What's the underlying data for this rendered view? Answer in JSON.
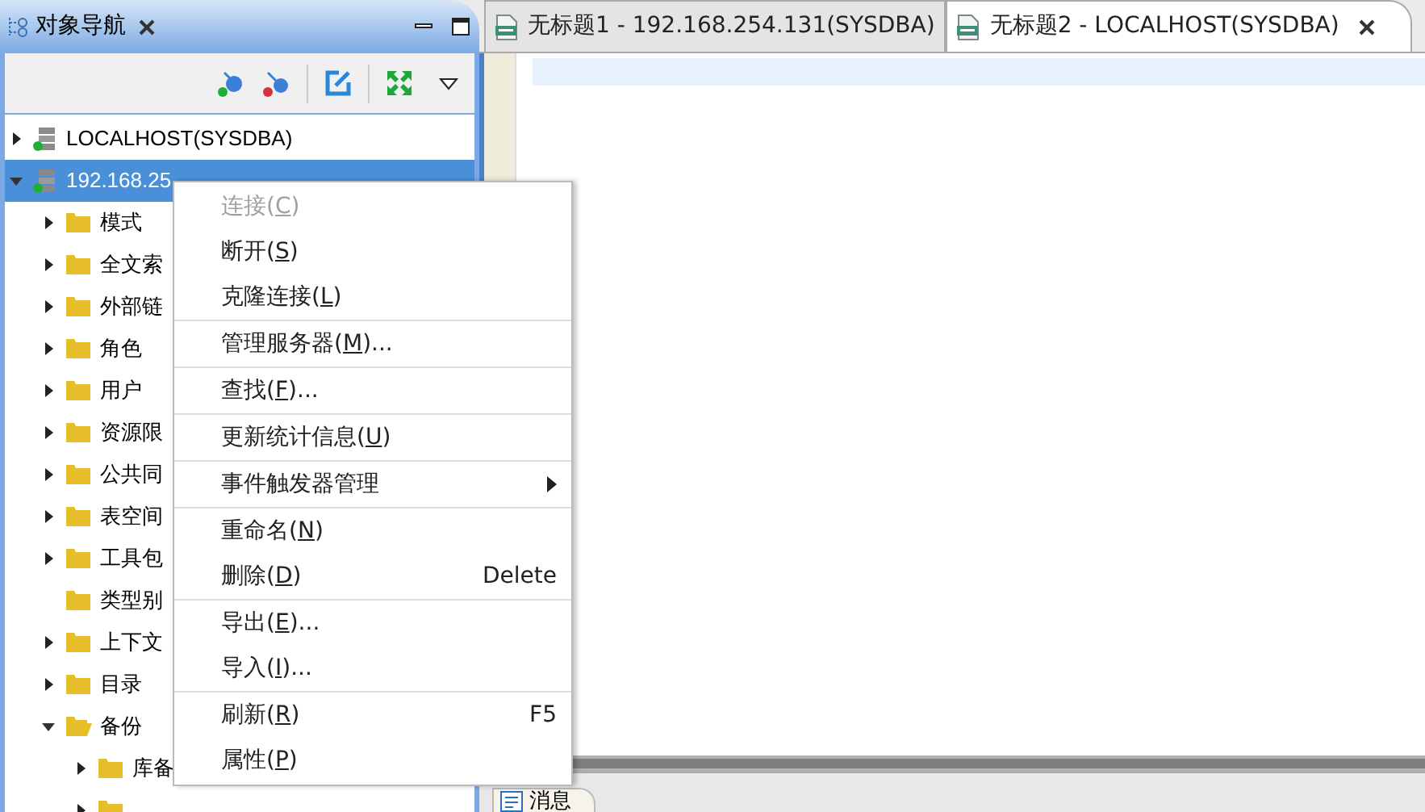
{
  "navigator": {
    "title": "对象导航"
  },
  "tree": [
    {
      "label": "LOCALHOST(SYSDBA)",
      "kind": "server",
      "expanded": false,
      "leaf": false,
      "selected": false
    },
    {
      "label": "192.168.25",
      "kind": "server",
      "expanded": true,
      "leaf": false,
      "selected": true,
      "children": [
        {
          "label": "模式",
          "kind": "folder",
          "expanded": false,
          "leaf": false,
          "selected": false
        },
        {
          "label": "全文索",
          "kind": "folder",
          "expanded": false,
          "leaf": false,
          "selected": false
        },
        {
          "label": "外部链",
          "kind": "folder",
          "expanded": false,
          "leaf": false,
          "selected": false
        },
        {
          "label": "角色",
          "kind": "folder",
          "expanded": false,
          "leaf": false,
          "selected": false
        },
        {
          "label": "用户",
          "kind": "folder",
          "expanded": false,
          "leaf": false,
          "selected": false
        },
        {
          "label": "资源限",
          "kind": "folder",
          "expanded": false,
          "leaf": false,
          "selected": false
        },
        {
          "label": "公共同",
          "kind": "folder",
          "expanded": false,
          "leaf": false,
          "selected": false
        },
        {
          "label": "表空间",
          "kind": "folder",
          "expanded": false,
          "leaf": false,
          "selected": false
        },
        {
          "label": "工具包",
          "kind": "folder",
          "expanded": false,
          "leaf": false,
          "selected": false
        },
        {
          "label": "类型别",
          "kind": "folder",
          "expanded": false,
          "leaf": true,
          "selected": false
        },
        {
          "label": "上下文",
          "kind": "folder",
          "expanded": false,
          "leaf": false,
          "selected": false
        },
        {
          "label": "目录",
          "kind": "folder",
          "expanded": false,
          "leaf": false,
          "selected": false
        },
        {
          "label": "备份",
          "kind": "folder",
          "expanded": true,
          "leaf": false,
          "selected": false,
          "children": [
            {
              "label": "库备",
              "kind": "folder",
              "expanded": false,
              "leaf": false,
              "selected": false
            },
            {
              "kind": "folder",
              "expanded": false,
              "leaf": false,
              "selected": false
            }
          ]
        }
      ]
    }
  ],
  "context_menu": [
    {
      "group": [
        {
          "label": "连接(",
          "key": "C",
          "tail": ")",
          "disabled": true,
          "submenu": false
        },
        {
          "label": "断开(",
          "key": "S",
          "tail": ")",
          "disabled": false,
          "submenu": false
        },
        {
          "label": "克隆连接(",
          "key": "L",
          "tail": ")",
          "disabled": false,
          "submenu": false
        }
      ]
    },
    {
      "group": [
        {
          "label": "管理服务器(",
          "key": "M",
          "tail": ")...",
          "disabled": false,
          "submenu": false
        }
      ]
    },
    {
      "group": [
        {
          "label": "查找(",
          "key": "F",
          "tail": ")...",
          "disabled": false,
          "submenu": false
        }
      ]
    },
    {
      "group": [
        {
          "label": "更新统计信息(",
          "key": "U",
          "tail": ")",
          "disabled": false,
          "submenu": false
        }
      ]
    },
    {
      "group": [
        {
          "label": "事件触发器管理",
          "disabled": false,
          "submenu": true
        }
      ]
    },
    {
      "group": [
        {
          "label": "重命名(",
          "key": "N",
          "tail": ")",
          "disabled": false,
          "submenu": false
        },
        {
          "label": "删除(",
          "key": "D",
          "tail": ")",
          "shortcut": "Delete",
          "disabled": false,
          "submenu": false
        }
      ]
    },
    {
      "group": [
        {
          "label": "导出(",
          "key": "E",
          "tail": ")...",
          "disabled": false,
          "submenu": false
        },
        {
          "label": "导入(",
          "key": "I",
          "tail": ")...",
          "disabled": false,
          "submenu": false
        }
      ]
    },
    {
      "group": [
        {
          "label": "刷新(",
          "key": "R",
          "tail": ")",
          "shortcut": "F5",
          "disabled": false,
          "submenu": false
        },
        {
          "label": "属性(",
          "key": "P",
          "tail": ")",
          "disabled": false,
          "submenu": false
        }
      ]
    }
  ],
  "editor_tabs": [
    {
      "label": "无标题1 - 192.168.254.131(SYSDBA)",
      "selected": false
    },
    {
      "label": "无标题2 - LOCALHOST(SYSDBA)",
      "selected": true
    }
  ],
  "bottom_tabs": [
    {
      "label": "消息",
      "selected": true
    }
  ]
}
